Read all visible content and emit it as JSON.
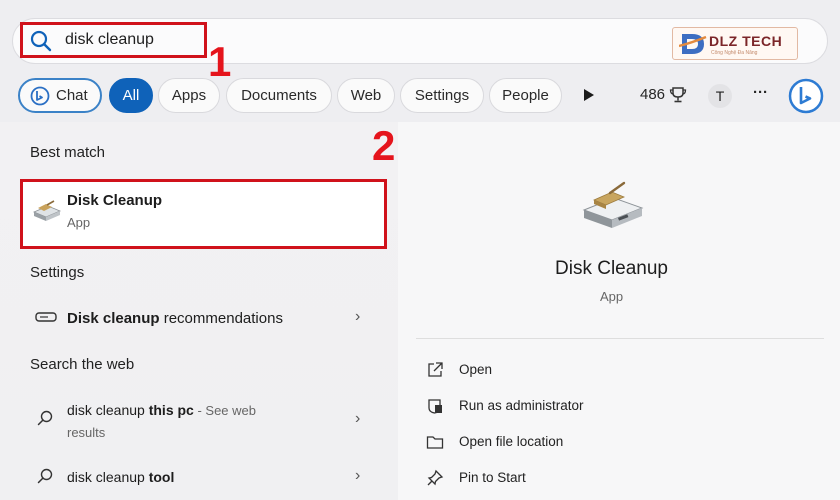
{
  "search": {
    "query": "disk cleanup"
  },
  "annotations": {
    "step1": "1",
    "step2": "2"
  },
  "logo": {
    "text": "DLZ TECH",
    "tagline": "Công Nghệ Đa Năng"
  },
  "filters": {
    "chat": "Chat",
    "all": "All",
    "apps": "Apps",
    "documents": "Documents",
    "web": "Web",
    "settings": "Settings",
    "people": "People",
    "points": "486",
    "avatar_initial": "T",
    "more": "···"
  },
  "best_match": {
    "heading": "Best match",
    "title": "Disk Cleanup",
    "subtitle": "App"
  },
  "settings_section": {
    "heading": "Settings",
    "item_bold": "Disk cleanup",
    "item_rest": " recommendations"
  },
  "web_section": {
    "heading": "Search the web",
    "item1_plain": "disk cleanup ",
    "item1_bold": "this pc",
    "item1_suffix": " - See web",
    "item1_line2": "results",
    "item2_plain": "disk cleanup ",
    "item2_bold": "tool"
  },
  "detail": {
    "title": "Disk Cleanup",
    "subtitle": "App",
    "actions": [
      "Open",
      "Run as administrator",
      "Open file location",
      "Pin to Start"
    ]
  },
  "colors": {
    "accent": "#0f62b9",
    "highlight": "#d0121b"
  }
}
